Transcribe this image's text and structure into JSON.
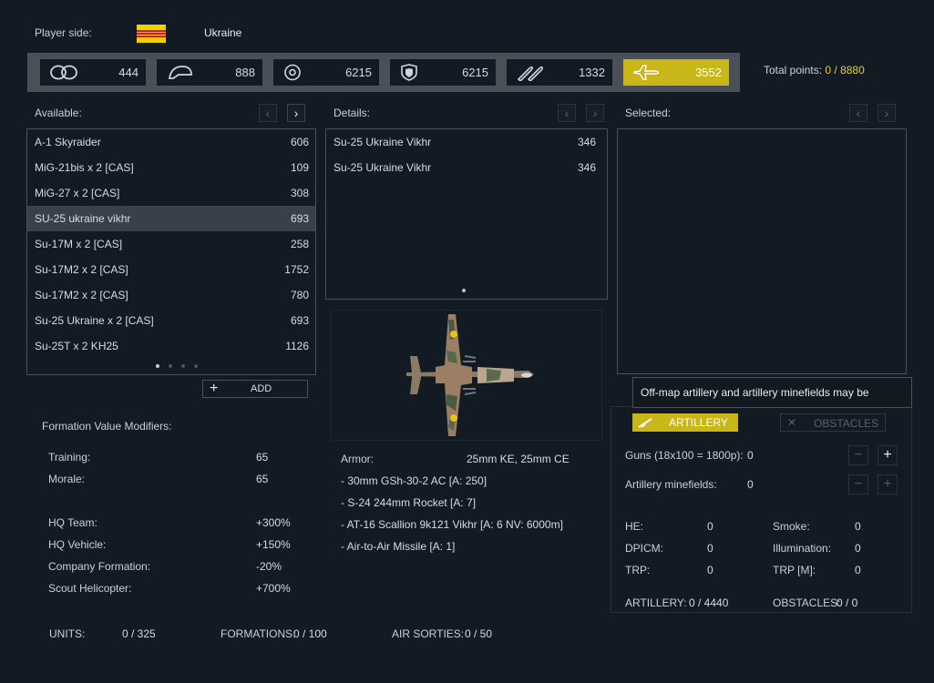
{
  "header": {
    "player_side_label": "Player side:",
    "side_name": "Ukraine",
    "flag_icon": "flag-icon"
  },
  "categories": [
    {
      "icon": "recon-icon",
      "value": "444"
    },
    {
      "icon": "helmet-icon",
      "value": "888"
    },
    {
      "icon": "tank-icon",
      "value": "6215"
    },
    {
      "icon": "shield-icon",
      "value": "6215"
    },
    {
      "icon": "ammo-icon",
      "value": "1332"
    },
    {
      "icon": "aircraft-icon",
      "value": "3552",
      "active": true
    }
  ],
  "total_points": {
    "label": "Total points:",
    "value": "0 / 8880"
  },
  "available": {
    "title": "Available:",
    "prev": "‹",
    "next": "›",
    "items": [
      {
        "name": "A-1 Skyraider",
        "value": "606"
      },
      {
        "name": "MiG-21bis x 2 [CAS]",
        "value": "109"
      },
      {
        "name": "MiG-27 x 2 [CAS]",
        "value": "308"
      },
      {
        "name": "SU-25 ukraine vikhr",
        "value": "693",
        "selected": true
      },
      {
        "name": "Su-17M x 2 [CAS]",
        "value": "258"
      },
      {
        "name": "Su-17M2 x 2 [CAS]",
        "value": "1752"
      },
      {
        "name": "Su-17M2 x 2 [CAS]",
        "value": "780"
      },
      {
        "name": "Su-25 Ukraine x 2 [CAS]",
        "value": "693"
      },
      {
        "name": "Su-25T x 2 KH25",
        "value": "1126"
      }
    ],
    "add_label": "ADD",
    "add_icon": "plus-icon"
  },
  "details": {
    "title": "Details:",
    "prev": "‹",
    "next": "›",
    "items": [
      {
        "name": "Su-25 Ukraine Vikhr",
        "value": "346"
      },
      {
        "name": "Su-25 Ukraine Vikhr",
        "value": "346"
      }
    ],
    "armor_label": "Armor:",
    "armor_value": "25mm KE, 25mm CE",
    "weapons": [
      "- 30mm GSh-30-2 AC [A: 250]",
      "- S-24 244mm Rocket [A: 7]",
      "- AT-16 Scallion 9k121 Vikhr [A: 6 NV: 6000m]",
      "- Air-to-Air Missile [A: 1]"
    ]
  },
  "selected": {
    "title": "Selected:",
    "prev": "‹",
    "next": "›"
  },
  "tooltip": "Off-map artillery and artillery minefields may be available.",
  "support": {
    "artillery_tab": "ARTILLERY",
    "obstacles_tab": "OBSTACLES",
    "guns_label": "Guns (18x100 = 1800p):",
    "guns_value": "0",
    "minefields_label": "Artillery minefields:",
    "minefields_value": "0",
    "stats": [
      {
        "label": "HE:",
        "value": "0"
      },
      {
        "label": "Smoke:",
        "value": "0"
      },
      {
        "label": "DPICM:",
        "value": "0"
      },
      {
        "label": "Illumination:",
        "value": "0"
      },
      {
        "label": "TRP:",
        "value": "0"
      },
      {
        "label": "TRP [M]:",
        "value": "0"
      }
    ],
    "artillery_total_label": "ARTILLERY:",
    "artillery_total_value": "0 / 4440",
    "obstacles_total_label": "OBSTACLES:",
    "obstacles_total_value": "0 / 0"
  },
  "modifiers": {
    "title": "Formation Value Modifiers:",
    "items": [
      {
        "label": "Training:",
        "value": "65"
      },
      {
        "label": "Morale:",
        "value": "65"
      },
      {
        "label": "HQ Team:",
        "value": "+300%"
      },
      {
        "label": "HQ Vehicle:",
        "value": "+150%"
      },
      {
        "label": "Company Formation:",
        "value": "-20%"
      },
      {
        "label": "Scout Helicopter:",
        "value": "+700%"
      }
    ]
  },
  "footer": {
    "units_label": "UNITS:",
    "units_value": "0 / 325",
    "formations_label": "FORMATIONS:",
    "formations_value": "0 / 100",
    "sorties_label": "AIR SORTIES:",
    "sorties_value": "0 / 50"
  }
}
